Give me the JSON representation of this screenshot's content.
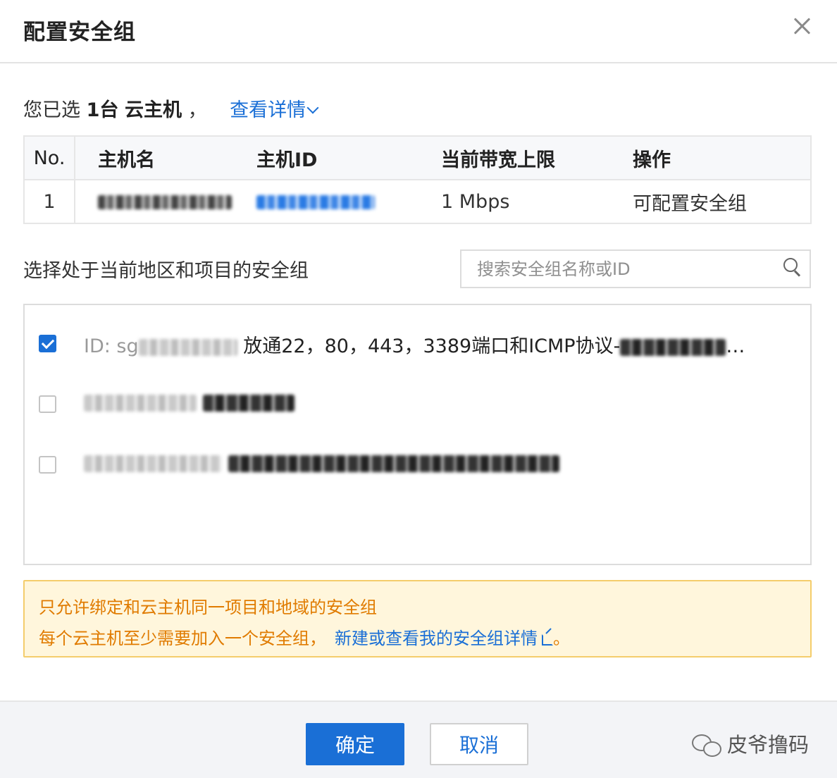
{
  "dialog": {
    "title": "配置安全组",
    "close_label": "✕"
  },
  "selection": {
    "prefix": "您已选",
    "count": "1台",
    "unit": "云主机",
    "separator": "，",
    "details_link": "查看详情"
  },
  "hosts_table": {
    "headers": [
      "No.",
      "主机名",
      "主机ID",
      "当前带宽上限",
      "操作"
    ],
    "rows": [
      {
        "no": "1",
        "name": "",
        "id": "",
        "bandwidth": "1 Mbps",
        "action": "可配置安全组"
      }
    ]
  },
  "security_groups": {
    "label": "选择处于当前地区和项目的安全组",
    "search_placeholder": "搜索安全组名称或ID",
    "items": [
      {
        "id_prefix": "ID: sg",
        "name": "放通22，80，443，3389端口和ICMP协议-",
        "checked": true
      },
      {
        "id_prefix": "",
        "name": "",
        "checked": false
      },
      {
        "id_prefix": "",
        "name": "",
        "checked": false
      }
    ]
  },
  "notice": {
    "line1": "只允许绑定和云主机同一项目和地域的安全组",
    "line2": "每个云主机至少需要加入一个安全组，",
    "link": "新建或查看我的安全组详情",
    "suffix": "。",
    "colors": {
      "text": "#e07b00",
      "background": "#fff6dc",
      "border": "#f4cd6c"
    }
  },
  "footer": {
    "ok_label": "确定",
    "cancel_label": "取消",
    "watermark": "皮爷撸码"
  },
  "colors": {
    "accent": "#1a6fd6"
  }
}
